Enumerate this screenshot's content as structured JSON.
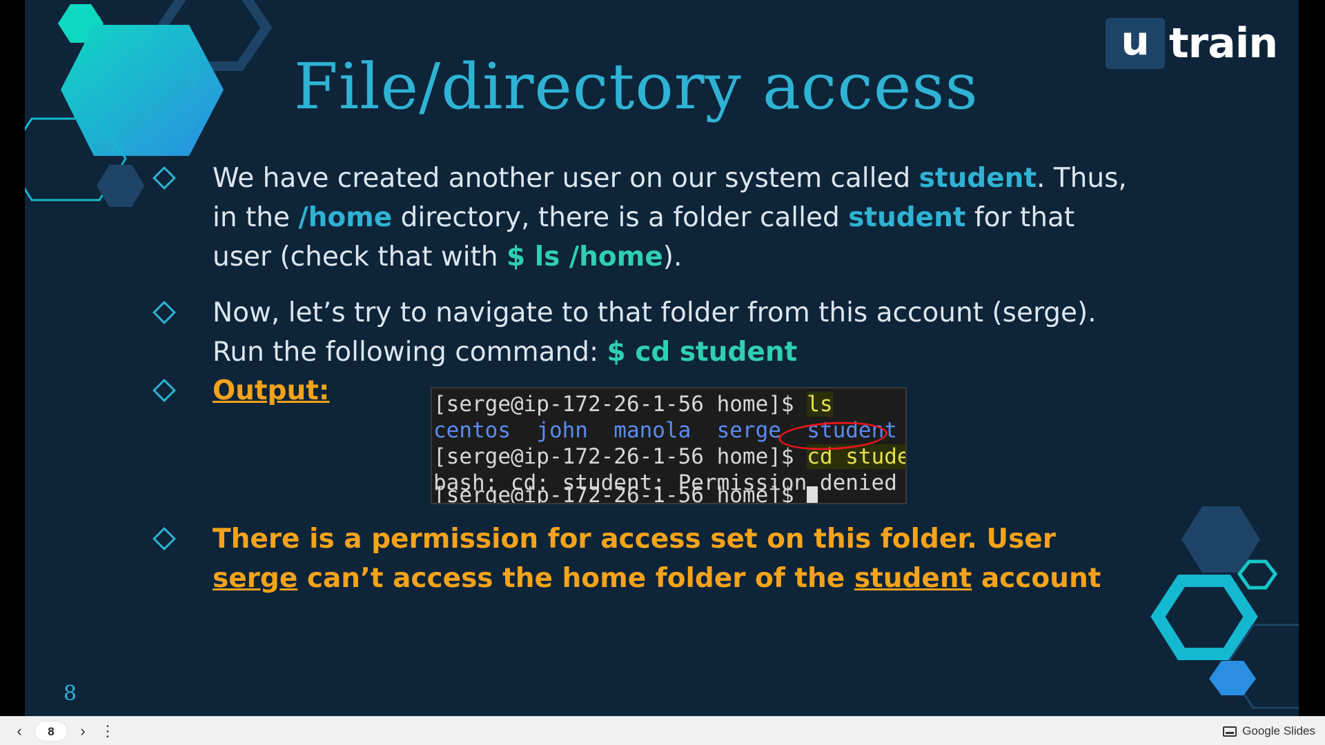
{
  "slide": {
    "title": "File/directory access",
    "logo": {
      "u": "u",
      "text": "train"
    },
    "page_number": "8",
    "bullets": [
      {
        "parts": [
          {
            "text": "We have created another user on our system called ",
            "style": "normal"
          },
          {
            "text": "student",
            "style": "hl"
          },
          {
            "text": ". Thus, in the ",
            "style": "normal"
          },
          {
            "text": "/home",
            "style": "hl"
          },
          {
            "text": " directory, there is a folder called ",
            "style": "normal"
          },
          {
            "text": "student",
            "style": "hl"
          },
          {
            "text": " for that user (check that with ",
            "style": "normal"
          },
          {
            "text": "$ ls /home",
            "style": "hl2"
          },
          {
            "text": ").",
            "style": "normal"
          }
        ]
      },
      {
        "parts": [
          {
            "text": "Now, let’s try to navigate to that folder from this account (serge). Run the following command: ",
            "style": "normal"
          },
          {
            "text": "$ cd student",
            "style": "hl2"
          }
        ]
      },
      {
        "parts": [
          {
            "text": "Output:",
            "style": "orange-u"
          }
        ]
      },
      {
        "parts": [
          {
            "text": "There is a permission for access set on this folder. User ",
            "style": "orange"
          },
          {
            "text": "serge",
            "style": "orange-u"
          },
          {
            "text": " can’t access the home folder of the ",
            "style": "orange"
          },
          {
            "text": "student",
            "style": "orange-u"
          },
          {
            "text": " account",
            "style": "orange"
          }
        ]
      }
    ],
    "terminal": {
      "prompt": "[serge@ip-172-26-1-56 home]$ ",
      "cmd1": "ls",
      "dirs": [
        "centos",
        "john",
        "manola",
        "serge",
        "student"
      ],
      "cmd2": "cd student",
      "error": "bash: cd: student: Permission denied",
      "partial_prompt": "[serge@ip-172-26-1-56 home]$ "
    },
    "colors": {
      "background": "#0e2439",
      "accent": "#2fb3d4",
      "highlight": "#2fcfb4",
      "warning": "#f4a31b"
    }
  },
  "bottom_bar": {
    "prev_icon": "‹",
    "page_value": "8",
    "next_icon": "›",
    "menu_icon": "⋮",
    "app_label": "Google Slides"
  }
}
